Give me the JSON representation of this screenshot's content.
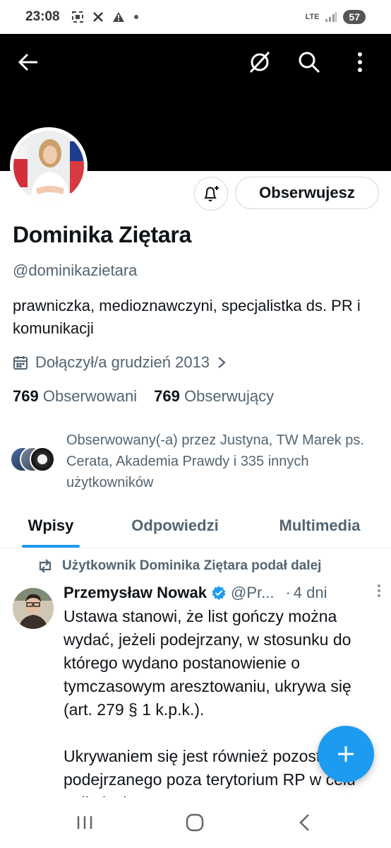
{
  "status_bar": {
    "time": "23:08",
    "left_icons": [
      "screenshot-icon",
      "x-icon",
      "warning-icon",
      "dot-icon"
    ],
    "network": "LTE",
    "battery": "57"
  },
  "header": {
    "back_icon": "arrow-left-icon",
    "grok_icon": "grok-icon",
    "search_icon": "search-icon",
    "more_icon": "more-vertical-icon"
  },
  "profile": {
    "name": "Dominika Ziętara",
    "handle": "@dominikazietara",
    "bio": "prawniczka, medioznawczyni, specjalistka ds. PR i komunikacji",
    "joined": "Dołączył/a grudzień 2013",
    "following_count": "769",
    "following_label": "Obserwowani",
    "followers_count": "769",
    "followers_label": "Obserwujący",
    "followed_by": "Obserwowany(-a) przez Justyna, TW Marek ps. Cerata, Akademia Prawdy i 335 innych użytkowników",
    "follow_button": "Obserwujesz"
  },
  "tabs": [
    {
      "label": "Wpisy",
      "active": true
    },
    {
      "label": "Odpowiedzi",
      "active": false
    },
    {
      "label": "Multimedia",
      "active": false
    }
  ],
  "tweet": {
    "repost_label": "Użytkownik Dominika Ziętara podał dalej",
    "author": "Przemysław Nowak",
    "handle": "@Pr...",
    "dot": "·",
    "time": "4 dni",
    "text": "Ustawa stanowi, że list gończy można wydać, jeżeli podejrzany, w stosunku do którego wydano postanowienie o tymczasowym aresztowaniu, ukrywa się (art. 279 § 1 k.p.k.).\n\nUkrywaniem się jest również pozostawanie podejrzanego poza terytorium RP w celu uniknięcia"
  },
  "colors": {
    "accent": "#1d9bf0",
    "text_primary": "#0f1419",
    "text_secondary": "#536471",
    "banner": "#000000"
  },
  "nav_bar": {
    "recent_icon": "recent-apps-icon",
    "home_icon": "home-icon",
    "back_icon": "back-icon"
  }
}
